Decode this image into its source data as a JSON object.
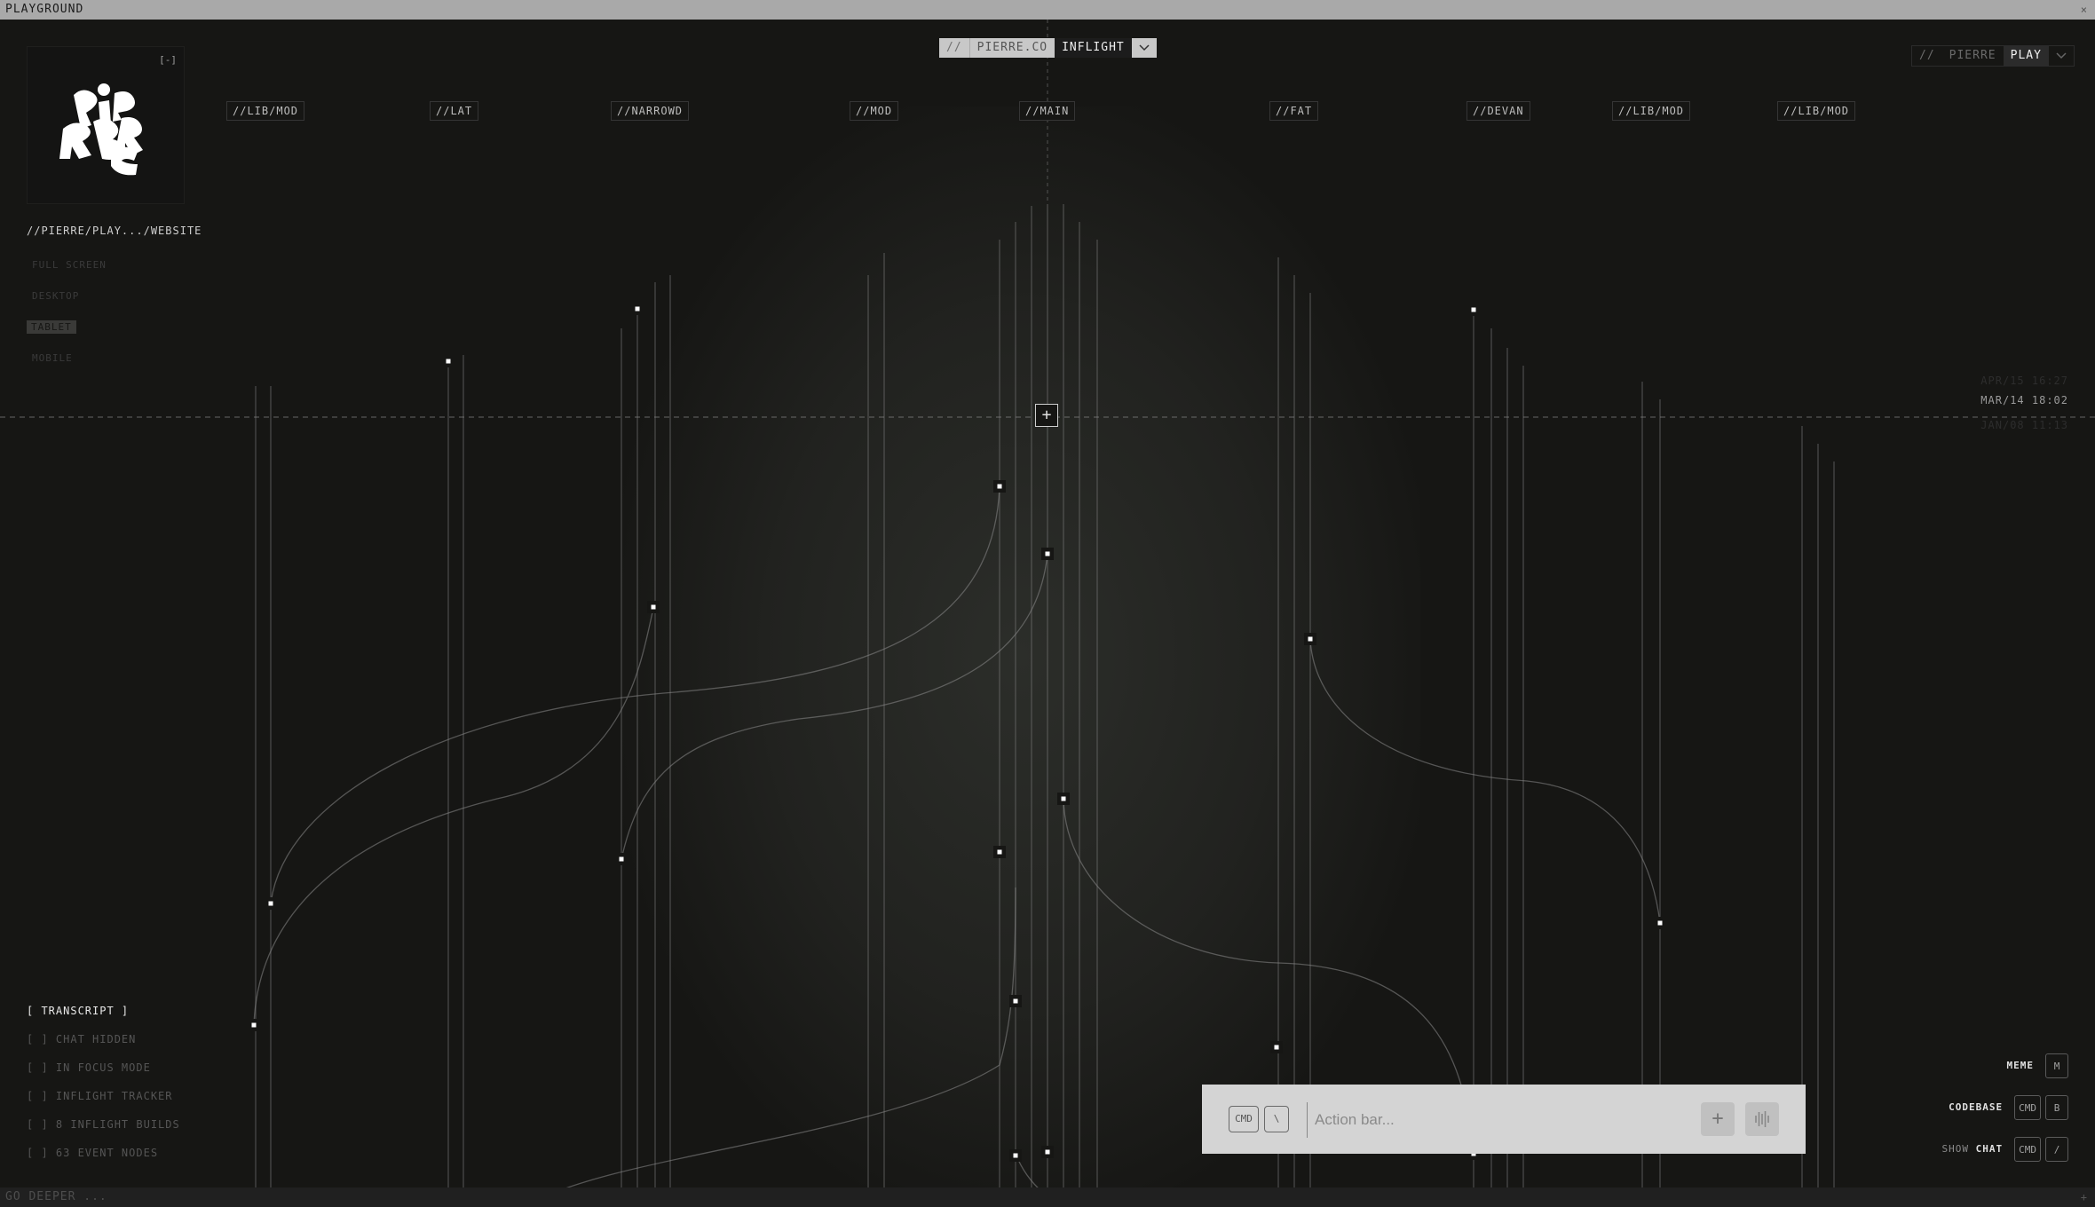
{
  "window": {
    "title": "PLAYGROUND",
    "footer_hint": "GO DEEPER ..."
  },
  "logo": {
    "collapse_label": "[-]",
    "alt": "PIERRE"
  },
  "breadcrumb": "//PIERRE/PLAY.../WEBSITE",
  "view_modes": {
    "items": [
      "FULL SCREEN",
      "DESKTOP",
      "TABLET",
      "MOBILE"
    ],
    "active": "TABLET"
  },
  "project_selector": {
    "prefix": "//",
    "domain": "PIERRE.CO",
    "selected": "INFLIGHT",
    "chevron": "chevron-down-icon"
  },
  "workspace_selector": {
    "prefix": "//",
    "org": "PIERRE",
    "selected": "PLAY",
    "chevron": "chevron-down-icon"
  },
  "branches": [
    "//LIB/MOD",
    "//LAT",
    "//NARROWD",
    "//MOD",
    "//MAIN",
    "//FAT",
    "//DEVAN",
    "//LIB/MOD",
    "//LIB/MOD"
  ],
  "timeline": {
    "timestamps": [
      "APR/15 16:27",
      "MAR/14 18:02",
      "JAN/08 11:13"
    ],
    "active": "MAR/14 18:02"
  },
  "status_list": {
    "items": [
      "[ TRANSCRIPT ]",
      "[ ] CHAT HIDDEN",
      "[ ] IN FOCUS MODE",
      "[ ] INFLIGHT TRACKER",
      "[ ] 8 INFLIGHT BUILDS",
      "[ ] 63 EVENT NODES"
    ],
    "active": "[ TRANSCRIPT ]"
  },
  "shortcuts": [
    {
      "label": "MEME",
      "keys": [
        "M"
      ]
    },
    {
      "label": "CODEBASE",
      "keys": [
        "CMD",
        "B"
      ]
    },
    {
      "label_dim": "SHOW",
      "label": "CHAT",
      "keys": [
        "CMD",
        "/"
      ]
    }
  ],
  "action_bar": {
    "keys": [
      "CMD",
      "\\"
    ],
    "placeholder": "Action bar...",
    "add_icon": "plus-icon",
    "voice_icon": "waveform-icon"
  },
  "colors": {
    "background": "#161614",
    "line": "#8a8a8a",
    "node": "#ffffff",
    "accent_bar": "#d4d4d4"
  }
}
